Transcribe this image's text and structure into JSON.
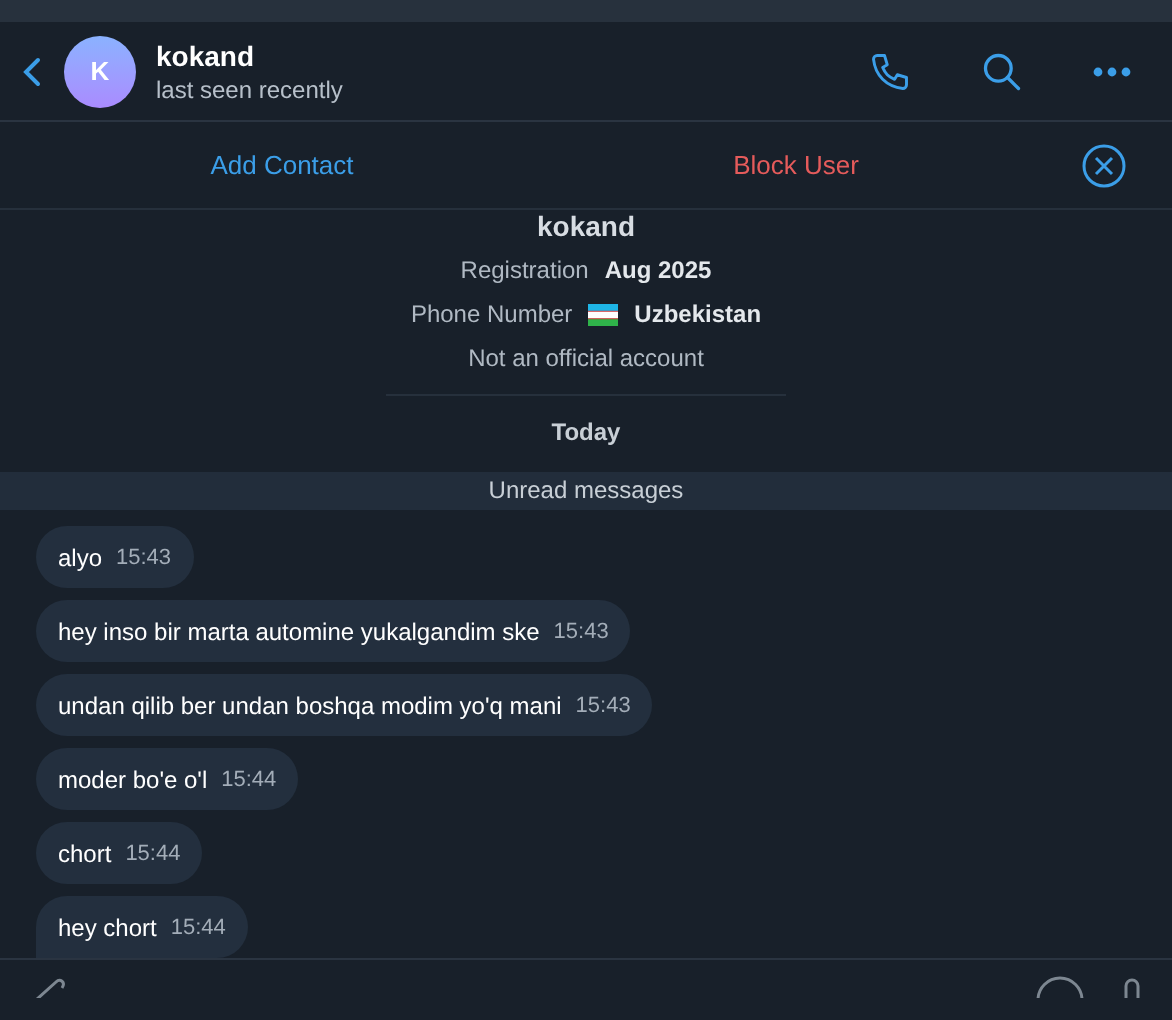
{
  "header": {
    "avatar_letter": "K",
    "name": "kokand",
    "status": "last seen recently"
  },
  "actions": {
    "add": "Add Contact",
    "block": "Block User"
  },
  "profile": {
    "name": "kokand",
    "rows": [
      {
        "label": "Registration",
        "value": "Aug 2025",
        "flag": false
      },
      {
        "label": "Phone Number",
        "value": "Uzbekistan",
        "flag": true
      }
    ],
    "note": "Not an official account"
  },
  "date_separator": "Today",
  "unread_bar": "Unread messages",
  "messages": [
    {
      "text": "alyo",
      "time": "15:43",
      "tail": false
    },
    {
      "text": "hey inso bir marta automine yukalgandim ske",
      "time": "15:43",
      "tail": false
    },
    {
      "text": "undan qilib ber undan boshqa modim yo'q mani",
      "time": "15:43",
      "tail": false
    },
    {
      "text": "moder bo'e o'l",
      "time": "15:44",
      "tail": false
    },
    {
      "text": "chort",
      "time": "15:44",
      "tail": false
    },
    {
      "text": "hey chort",
      "time": "15:44",
      "tail": true
    }
  ]
}
